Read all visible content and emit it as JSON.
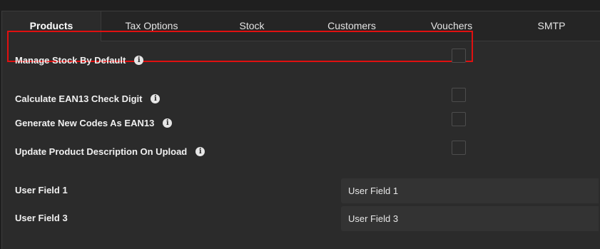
{
  "tabs": [
    {
      "label": "Products",
      "active": true
    },
    {
      "label": "Tax Options"
    },
    {
      "label": "Stock"
    },
    {
      "label": "Customers"
    },
    {
      "label": "Vouchers"
    },
    {
      "label": "SMTP"
    }
  ],
  "settings": {
    "manage_stock": {
      "label": "Manage Stock By Default",
      "checked": false
    },
    "calc_ean13": {
      "label": "Calculate EAN13 Check Digit",
      "checked": false
    },
    "gen_ean13": {
      "label": "Generate New Codes As EAN13",
      "checked": false
    },
    "update_desc": {
      "label": "Update Product Description On Upload",
      "checked": false
    }
  },
  "fields": {
    "user_field_1": {
      "label": "User Field 1",
      "value": "User Field 1"
    },
    "user_field_3": {
      "label": "User Field 3",
      "value": "User Field 3"
    }
  },
  "icons": {
    "info": "info-icon"
  },
  "colors": {
    "highlight": "#e01010",
    "background": "#2b2b2b"
  }
}
